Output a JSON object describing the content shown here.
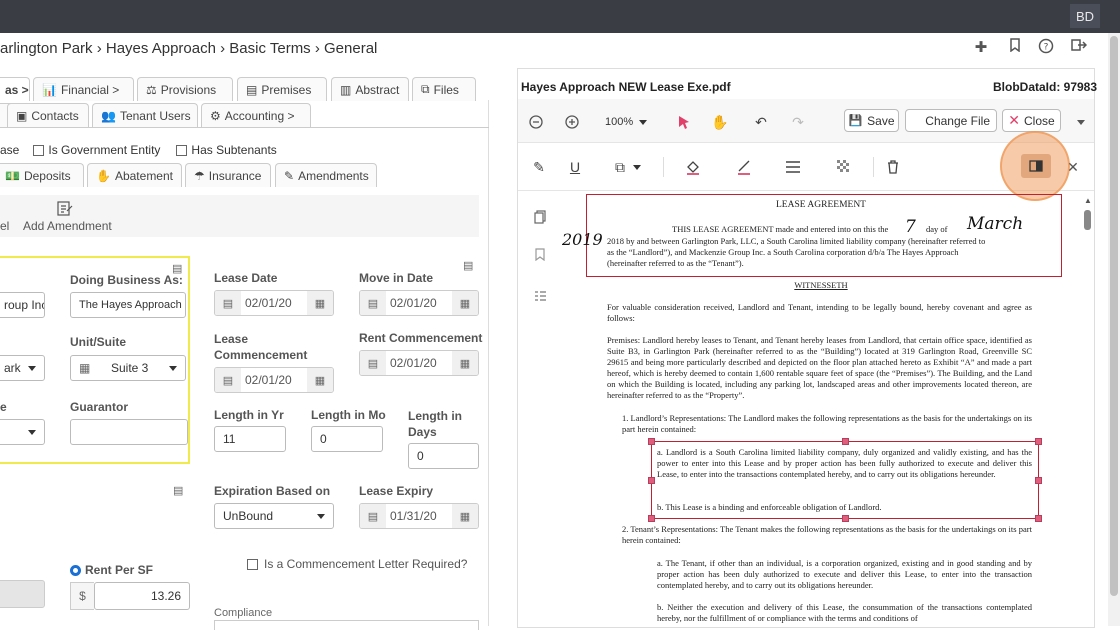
{
  "topbar": {
    "avatar": "BD"
  },
  "breadcrumb": "arlington Park › Hayes Approach › Basic Terms › General",
  "tabs_row1": [
    "as >",
    "Financial >",
    "Provisions",
    "Premises",
    "Abstract",
    "Files"
  ],
  "tabs_row2": [
    "Contacts",
    "Tenant Users",
    "Accounting >"
  ],
  "checks": {
    "lease": "ase",
    "gov": "Is Government Entity",
    "sub": "Has Subtenants"
  },
  "subtabs": [
    "Deposits",
    "Abatement",
    "Insurance",
    "Amendments"
  ],
  "actions": {
    "cancel": "el",
    "add_amendment": "Add Amendment"
  },
  "form": {
    "dba_label": "Doing Business As:",
    "dba_value": "The Hayes Approach",
    "name_partial": "roup Inc",
    "unit_label": "Unit/Suite",
    "unit_value": "Suite 3",
    "prop_partial": "ark",
    "guarantor_label": "Guarantor",
    "type_partial": "e",
    "lease_date_label": "Lease Date",
    "lease_date": "02/01/20",
    "move_in_label": "Move in Date",
    "move_in": "02/01/20",
    "lease_comm_label": "Lease Commencement",
    "lease_comm": "02/01/20",
    "rent_comm_label": "Rent Commencement",
    "rent_comm": "02/01/20",
    "len_yr_label": "Length in Yr",
    "len_yr": "11",
    "len_mo_label": "Length in Mo",
    "len_mo": "0",
    "len_days_label": "Length in Days",
    "len_days": "0",
    "exp_based_label": "Expiration Based on",
    "exp_based": "UnBound",
    "lease_expiry_label": "Lease Expiry",
    "lease_expiry": "01/31/20",
    "comm_letter": "Is a Commencement Letter Required?",
    "rent_sf_label": "Rent Per SF",
    "currency": "$",
    "rent_sf": "13.26",
    "compliance_label": "Compliance"
  },
  "viewer": {
    "filename": "Hayes Approach NEW Lease Exe.pdf",
    "blob": "BlobDataId: 97983",
    "zoom": "100%",
    "save": "Save",
    "change_file": "Change File",
    "close": "Close"
  },
  "pdf": {
    "title": "LEASE AGREEMENT",
    "hw_day": "7",
    "hw_month": "March",
    "hw_year": "2019",
    "intro1": "THIS LEASE AGREEMENT made and entered into on this the",
    "intro1b": "day of",
    "intro2": "2018 by and between Garlington Park, LLC, a South Carolina limited liability company (hereinafter referred to",
    "intro3": "as the “Landlord”), and Mackenzie Group Inc. a South Carolina corporation d/b/a The Hayes Approach",
    "intro4": "(hereinafter referred to as the “Tenant”).",
    "witnesseth": "WITNESSETH",
    "p1": "For valuable consideration received, Landlord and Tenant, intending to be legally bound, hereby covenant and agree as follows:",
    "p2": "Premises: Landlord hereby leases to Tenant, and Tenant hereby leases from Landlord, that certain office space, identified as Suite B3, in Garlington Park (hereinafter referred to as the “Building”) located at 319 Garlington Road, Greenville SC 29615 and being more particularly described and depicted on the floor plan attached hereto as Exhibit “A” and made a part hereof, which is hereby deemed to contain 1,600 rentable square feet of space (the “Premises”). The Building, and the Land on which the Building is located, including any parking lot, landscaped areas and other improvements located thereon, are hereinafter referred to as the “Property”.",
    "s1": "1.  Landlord’s Representations: The Landlord makes the following representations as the basis for the undertakings on its part herein contained:",
    "s1a": "a.   Landlord is a South Carolina limited liability company, duly organized and validly existing, and has the power to enter into this Lease and by proper action has been fully authorized to execute and deliver this Lease, to enter into the transactions contemplated hereby, and to carry out its obligations hereunder.",
    "s1b": "b.   This Lease is a binding and enforceable obligation of Landlord.",
    "s2": "2.  Tenant’s Representations: The Tenant makes the following representations as the basis for the undertakings on its part herein contained:",
    "s2a": "a.   The Tenant, if other than an individual, is a corporation organized, existing and in good standing and by proper action has been duly authorized to execute and deliver this Lease, to enter into the transaction contemplated hereby, and to carry out its obligations hereunder.",
    "s2b": "b.   Neither the execution and delivery of this Lease, the consummation of the transactions contemplated hereby, nor the fulfillment of or compliance with the terms and conditions of"
  }
}
